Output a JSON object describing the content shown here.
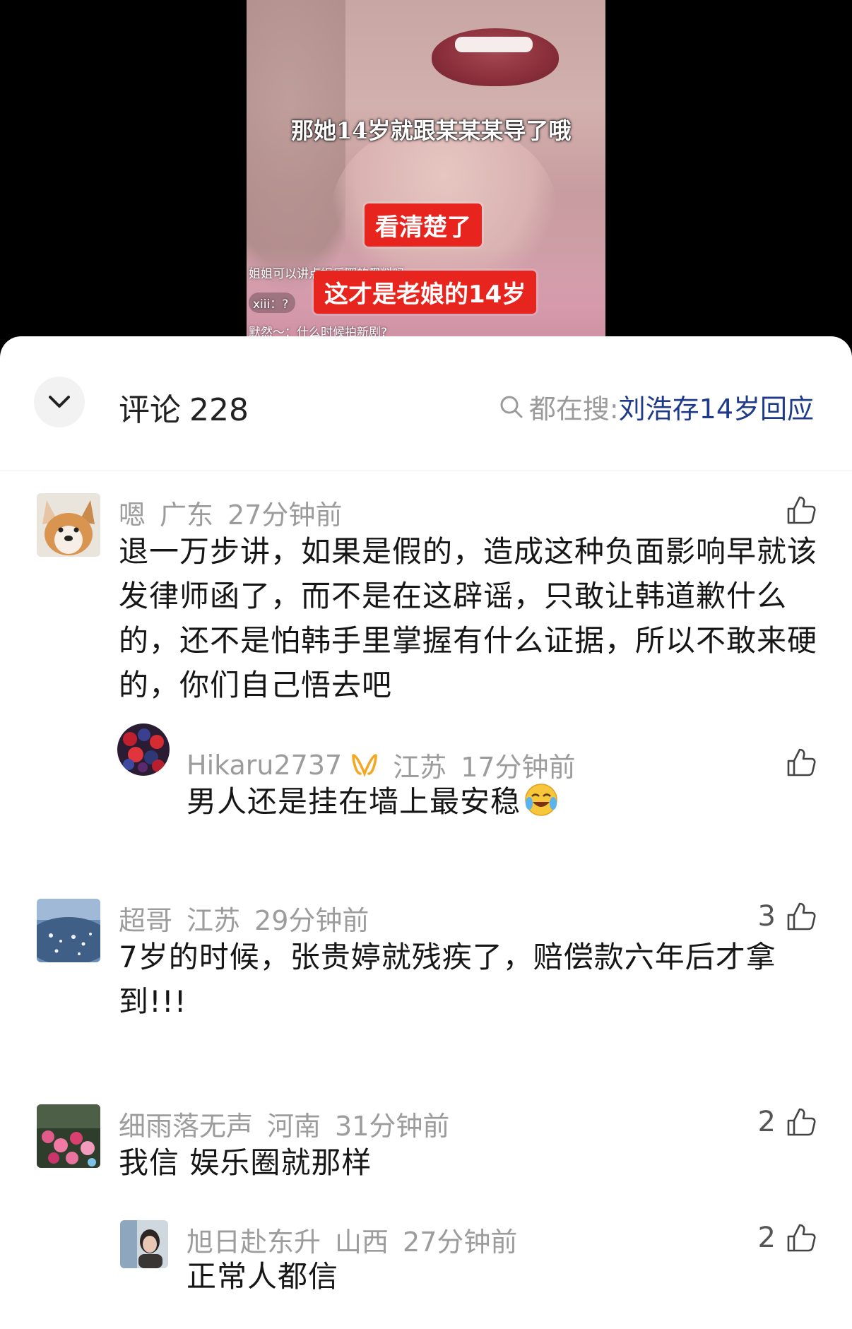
{
  "video": {
    "subtitle": "那她14岁就跟某某某导了哦",
    "sticker_1": "看清楚了",
    "sticker_2": "这才是老娘的14岁",
    "danmu": [
      "姐姐可以讲点娱乐圈的黑料吗",
      "xiii：?",
      "默然～：什么时候拍新剧?"
    ]
  },
  "header": {
    "title": "评论",
    "count": "228",
    "trending_label": "都在搜:",
    "trending_term": "刘浩存14岁回应"
  },
  "comments": [
    {
      "user": "嗯",
      "location": "广东",
      "time": "27分钟前",
      "text": "退一万步讲，如果是假的，造成这种负面影响早就该发律师函了，而不是在这辟谣，只敢让韩道歉什么的，还不是怕韩手里掌握有什么证据，所以不敢来硬的，你们自己悟去吧",
      "likes": "",
      "reply": {
        "user": "Hikaru2737",
        "location": "江苏",
        "time": "17分钟前",
        "text": "男人还是挂在墙上最安稳",
        "likes": ""
      }
    },
    {
      "user": "超哥",
      "location": "江苏",
      "time": "29分钟前",
      "text": "7岁的时候，张贵婷就残疾了，赔偿款六年后才拿到!!!",
      "likes": "3"
    },
    {
      "user": "细雨落无声",
      "location": "河南",
      "time": "31分钟前",
      "text": "我信 娱乐圈就那样",
      "likes": "2",
      "reply": {
        "user": "旭日赴东升",
        "location": "山西",
        "time": "27分钟前",
        "text": "正常人都信",
        "likes": "2"
      }
    }
  ],
  "colors": {
    "accent_link": "#1e3a8a",
    "meta_gray": "#9c9c9c",
    "sticker_red": "#e8241f"
  }
}
